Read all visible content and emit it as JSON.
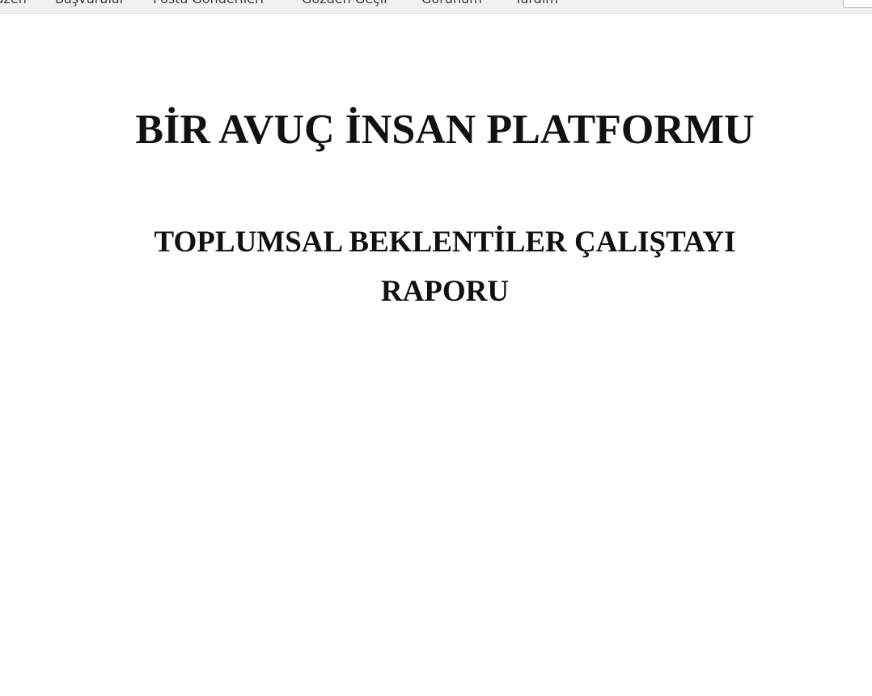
{
  "menubar": {
    "items": [
      {
        "label": "Düzen"
      },
      {
        "label": "Başvurular"
      },
      {
        "label": "Posta Gönderileri"
      },
      {
        "label": "Gözden Geçir"
      },
      {
        "label": "Görünüm"
      },
      {
        "label": "Yardım"
      }
    ]
  },
  "document": {
    "title": "BİR AVUÇ İNSAN PLATFORMU",
    "subtitle_line1": "TOPLUMSAL BEKLENTİLER ÇALIŞTAYI",
    "subtitle_line2": "RAPORU"
  },
  "colors": {
    "menubar_bg": "#f0f0f0",
    "page_bg": "#ffffff",
    "text": "#111111"
  }
}
